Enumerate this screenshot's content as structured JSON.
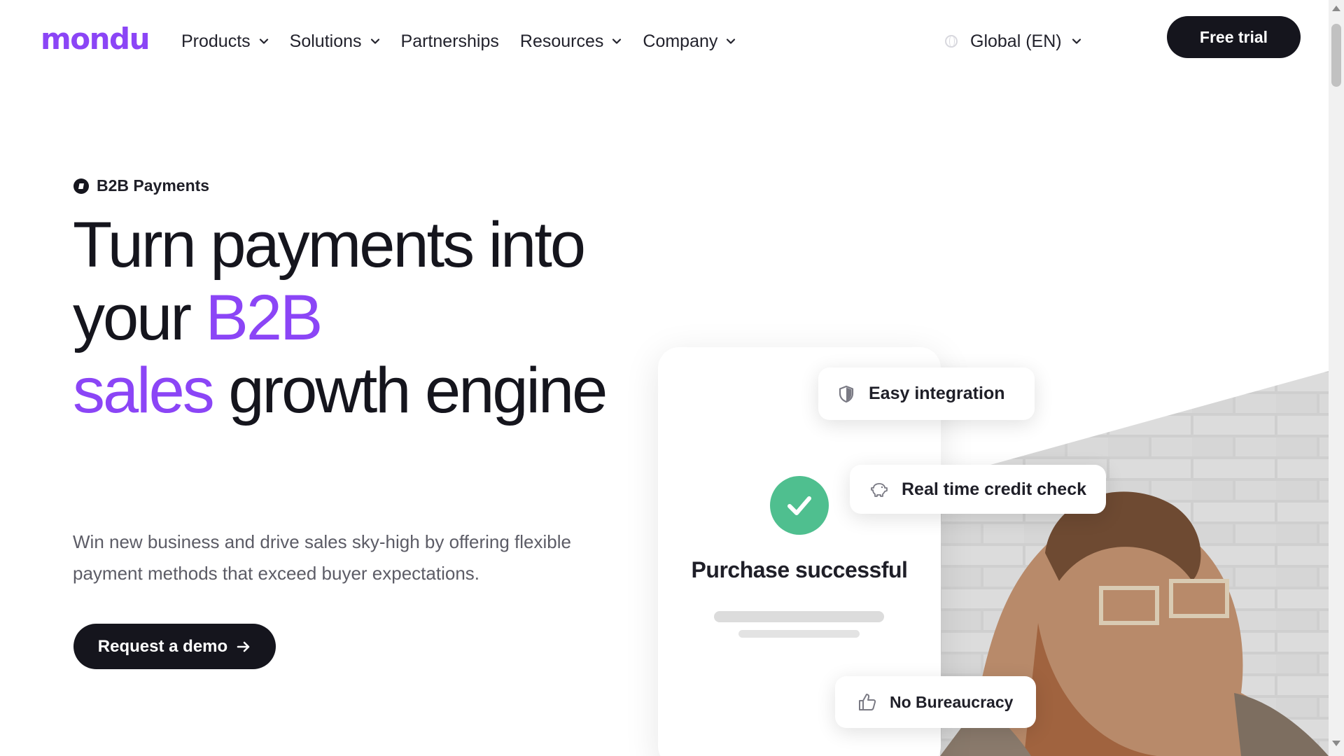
{
  "brand": {
    "logo_text": "mondu",
    "accent_color": "#8b45f6",
    "dark_color": "#15151d"
  },
  "nav": {
    "items": [
      {
        "label": "Products",
        "has_dropdown": true
      },
      {
        "label": "Solutions",
        "has_dropdown": true
      },
      {
        "label": "Partnerships",
        "has_dropdown": false
      },
      {
        "label": "Resources",
        "has_dropdown": true
      },
      {
        "label": "Company",
        "has_dropdown": true
      }
    ],
    "language": "Global (EN)",
    "cta": "Free trial"
  },
  "hero": {
    "eyebrow": "B2B Payments",
    "headline_part1": "Turn payments into your ",
    "headline_accent1": "B2B",
    "headline_accent2": "sales",
    "headline_part2": " growth engine",
    "subtext": "Win new business and drive sales sky-high by offering flexible payment methods that exceed buyer expectations.",
    "cta": "Request a demo"
  },
  "visual": {
    "status_text": "Purchase successful",
    "status_color": "#4fbf8f",
    "pills": [
      {
        "label": "Easy integration",
        "icon": "shield-icon"
      },
      {
        "label": "Real time credit check",
        "icon": "piggy-bank-icon"
      },
      {
        "label": "No Bureaucracy",
        "icon": "thumbs-up-icon"
      }
    ]
  }
}
